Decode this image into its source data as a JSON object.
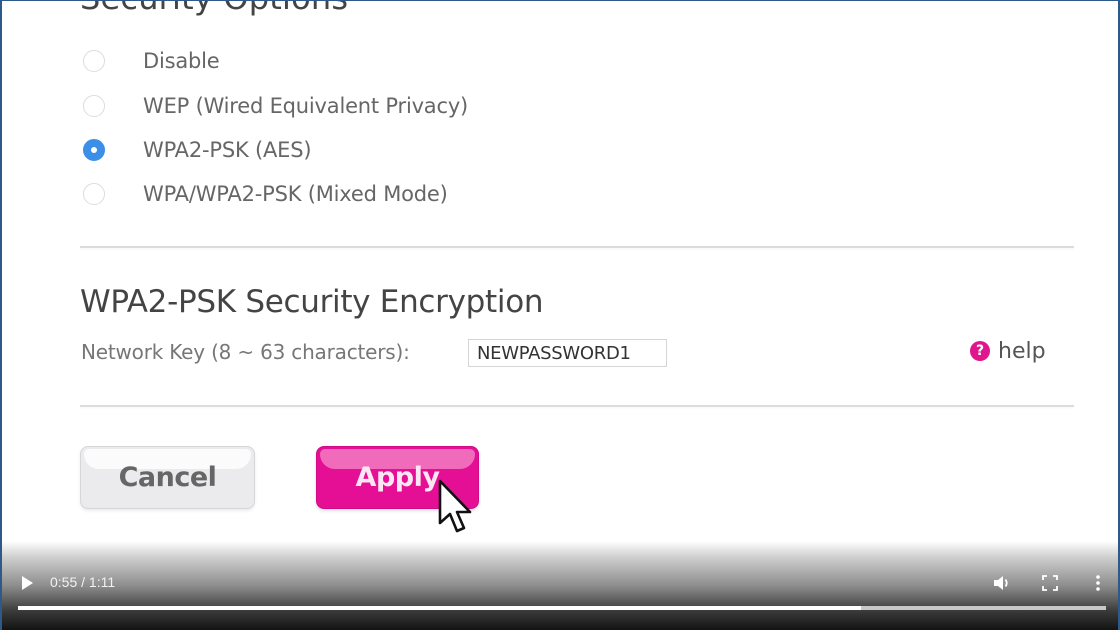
{
  "security_options": {
    "title": "Security Options",
    "options": [
      {
        "label": "Disable",
        "checked": false
      },
      {
        "label": "WEP (Wired Equivalent Privacy)",
        "checked": false
      },
      {
        "label": "WPA2-PSK (AES)",
        "checked": true
      },
      {
        "label": "WPA/WPA2-PSK (Mixed Mode)",
        "checked": false
      }
    ]
  },
  "encryption": {
    "title": "WPA2-PSK Security Encryption",
    "network_key_label": "Network Key (8 ~ 63 characters):",
    "network_key_value": "NEWPASSWORD1",
    "help_icon": "question-circle-icon",
    "help_label": "help"
  },
  "buttons": {
    "cancel_label": "Cancel",
    "apply_label": "Apply"
  },
  "colors": {
    "accent": "#e50f96",
    "radio_selected": "#3b8fe8"
  },
  "video_player": {
    "play_icon": "play-icon",
    "current_time": "0:55",
    "duration": "1:11",
    "time_display": "0:55 / 1:11",
    "progress_fraction": 0.775,
    "volume_icon": "volume-icon",
    "fullscreen_icon": "fullscreen-icon",
    "more_icon": "more-vertical-icon"
  }
}
